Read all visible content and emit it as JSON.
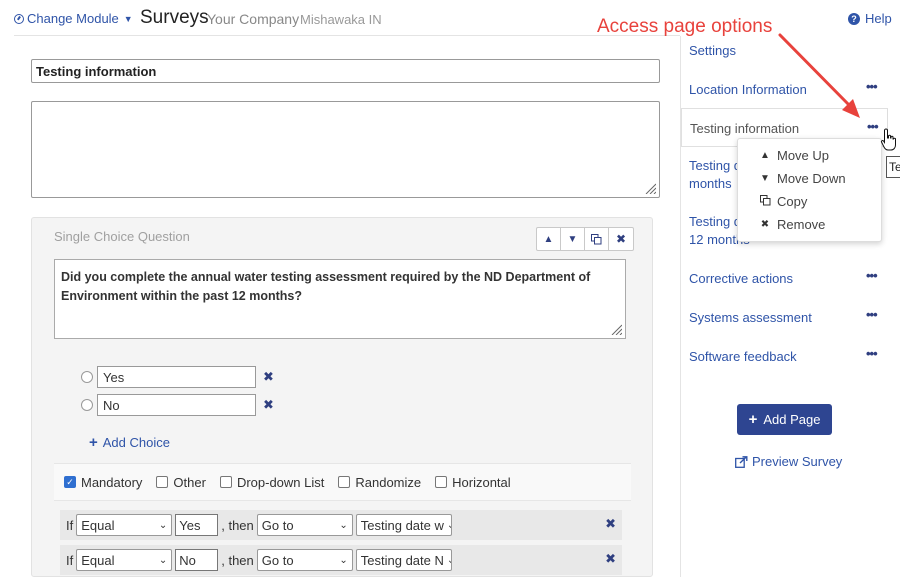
{
  "header": {
    "change_module_label": "Change Module",
    "app_title": "Surveys",
    "company": "Your Company",
    "location": "Mishawaka IN",
    "help_label": "Help"
  },
  "annotation": {
    "text": "Access page options",
    "color": "#e8423c"
  },
  "page": {
    "title_value": "Testing information",
    "description_value": ""
  },
  "question": {
    "type_label": "Single Choice Question",
    "text": "Did you complete the annual water testing assessment required by the ND Department of Environment within the past 12 months?",
    "choices": [
      {
        "value": "Yes"
      },
      {
        "value": "No"
      }
    ],
    "add_choice_label": "Add Choice",
    "options": [
      {
        "label": "Mandatory",
        "checked": true
      },
      {
        "label": "Other",
        "checked": false
      },
      {
        "label": "Drop-down List",
        "checked": false
      },
      {
        "label": "Randomize",
        "checked": false
      },
      {
        "label": "Horizontal",
        "checked": false
      }
    ],
    "logic": [
      {
        "if_label": "If",
        "operator": "Equal",
        "value": "Yes",
        "then_label": ", then",
        "action": "Go to",
        "target": "Testing date w"
      },
      {
        "if_label": "If",
        "operator": "Equal",
        "value": "No",
        "then_label": ", then",
        "action": "Go to",
        "target": "Testing date N"
      }
    ]
  },
  "sidebar": {
    "items": [
      {
        "label": "Settings",
        "has_menu": false
      },
      {
        "label": "Location Information",
        "has_menu": true
      },
      {
        "label": "Testing information",
        "has_menu": true,
        "selected": true
      },
      {
        "label": "Testing da\nmonths",
        "has_menu": false
      },
      {
        "label": "Testing da\n12 months",
        "has_menu": false
      },
      {
        "label": "Corrective actions",
        "has_menu": true
      },
      {
        "label": "Systems assessment",
        "has_menu": true
      },
      {
        "label": "Software feedback",
        "has_menu": true
      }
    ],
    "menu_dots": "•••",
    "add_page_label": "Add Page",
    "preview_label": "Preview Survey"
  },
  "page_menu": {
    "items": [
      {
        "label": "Move Up",
        "icon": "caret-up-icon"
      },
      {
        "label": "Move Down",
        "icon": "caret-down-icon"
      },
      {
        "label": "Copy",
        "icon": "copy-icon"
      },
      {
        "label": "Remove",
        "icon": "close-icon"
      }
    ]
  },
  "tooltip_fragment": "Te",
  "colors": {
    "link": "#2f54a8",
    "primary_button": "#2e4591",
    "icon_dark": "#2f3f80"
  }
}
